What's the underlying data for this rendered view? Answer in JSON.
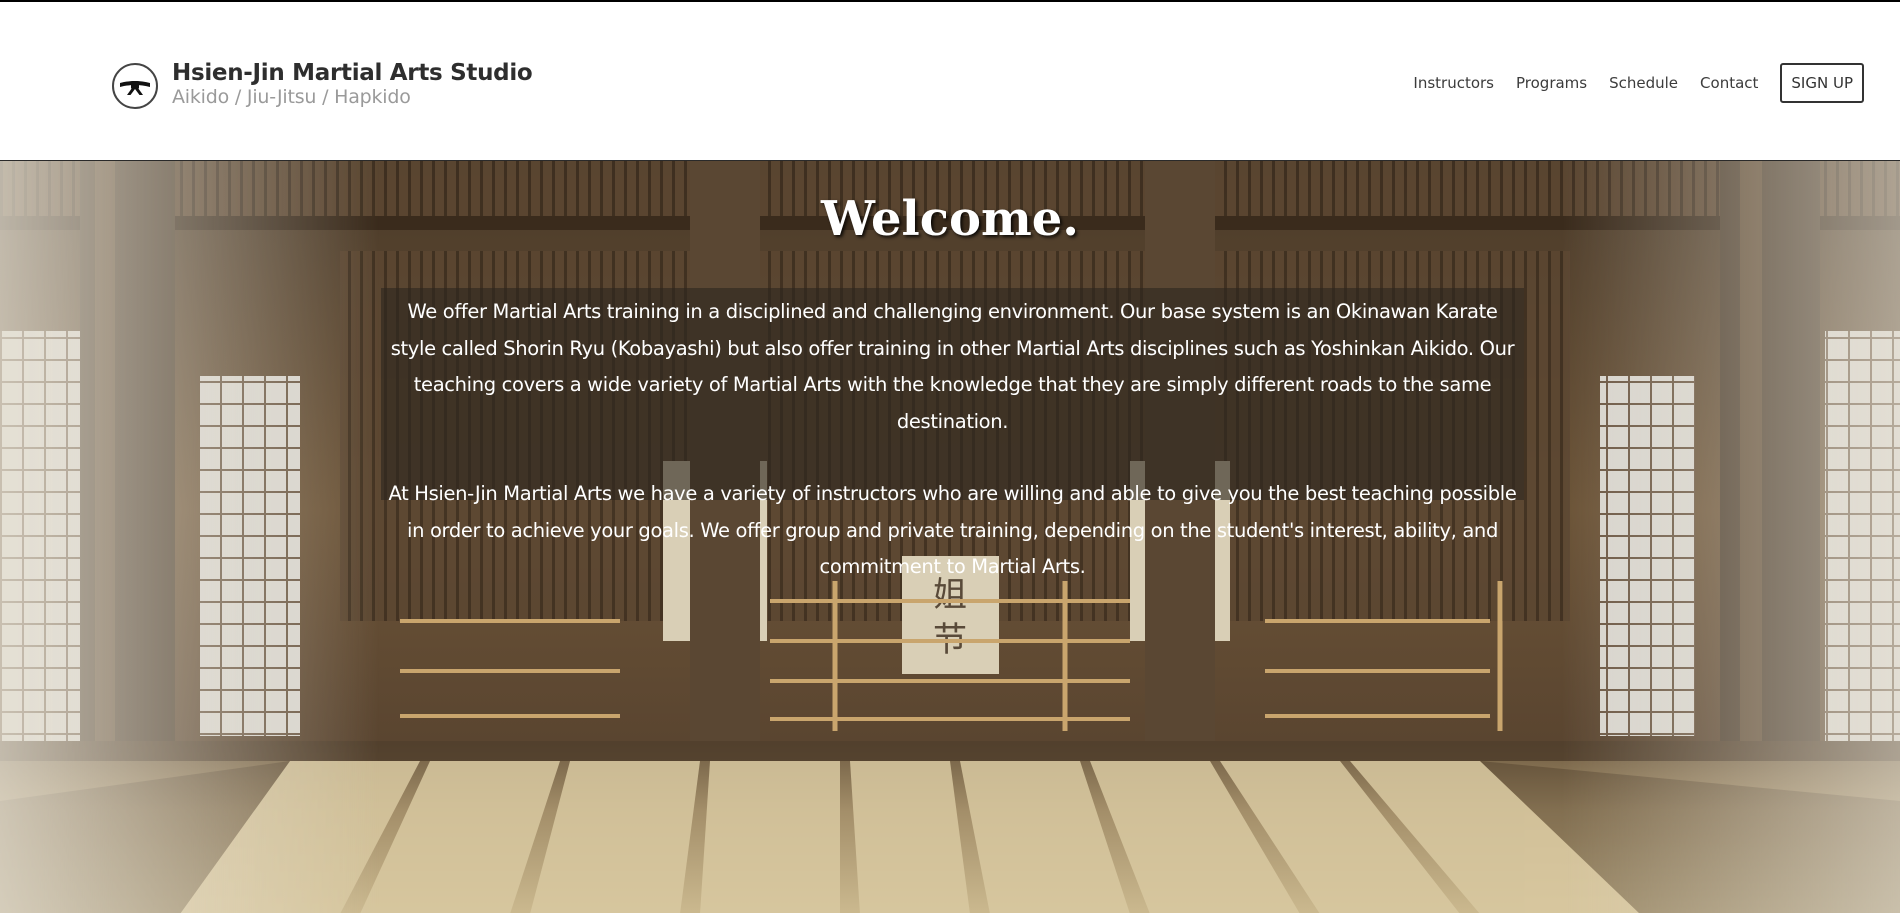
{
  "header": {
    "logo_icon": "black-belt-icon",
    "title": "Hsien-Jin Martial Arts Studio",
    "tagline": "Aikido / Jiu-Jitsu / Hapkido"
  },
  "nav": {
    "links": [
      "Instructors",
      "Programs",
      "Schedule",
      "Contact"
    ],
    "signup_label": "SIGN UP"
  },
  "hero": {
    "heading": "Welcome.",
    "paragraph_1": "We offer Martial Arts training in a disciplined and challenging environment. Our base system is an Okinawan Karate style called Shorin Ryu (Kobayashi) but also offer training in other Martial Arts disciplines such as Yoshinkan Aikido. Our teaching covers a wide variety of Martial Arts with the knowledge that they are simply different roads to the same destination.",
    "paragraph_2": "At Hsien-Jin Martial Arts we have a variety of instructors who are willing and able to give you the best teaching possible in order to achieve your goals. We offer group and private training, depending on the student's interest, ability, and commitment to Martial Arts.",
    "background": "dojo-interior-image"
  },
  "colors": {
    "title": "#2e2e2e",
    "tagline": "#9a9a9a",
    "nav_text": "#3c3c3c",
    "hero_text": "#ffffff",
    "overlay": "#2d261e"
  }
}
